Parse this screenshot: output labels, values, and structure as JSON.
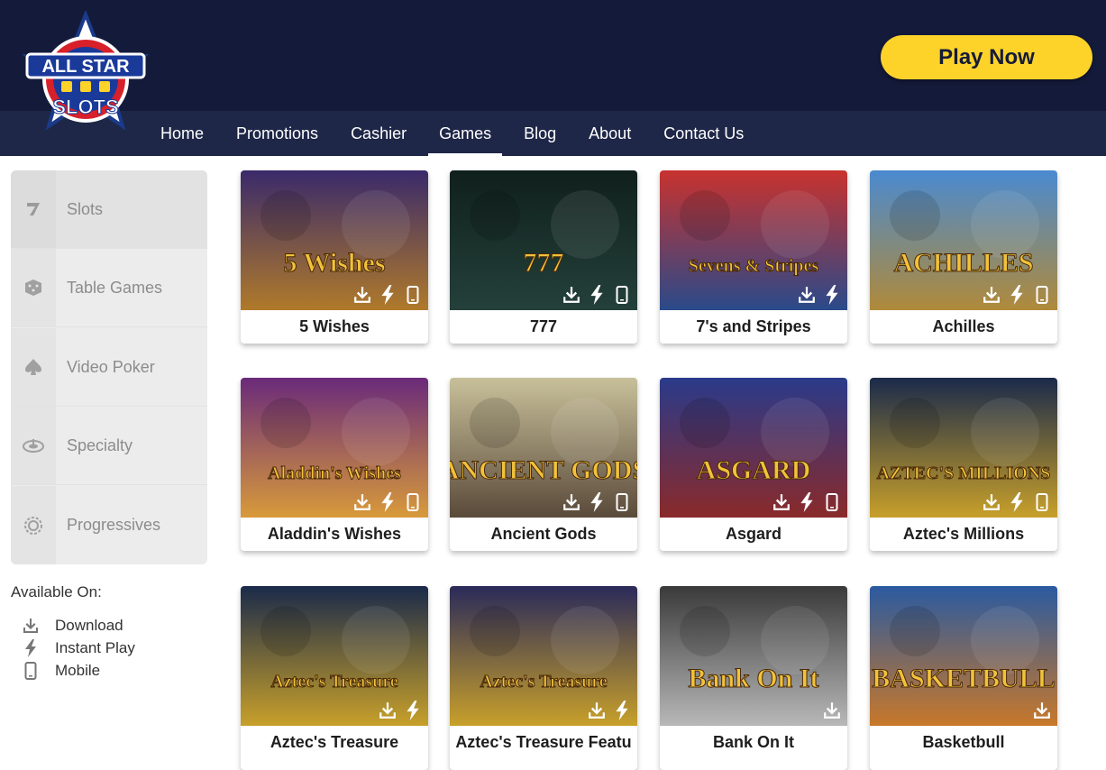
{
  "brand": {
    "logo_line1": "ALL STAR",
    "logo_line2": "SLOTS"
  },
  "header": {
    "play_now_label": "Play Now"
  },
  "nav": {
    "items": [
      {
        "label": "Home"
      },
      {
        "label": "Promotions"
      },
      {
        "label": "Cashier"
      },
      {
        "label": "Games",
        "active": true
      },
      {
        "label": "Blog"
      },
      {
        "label": "About"
      },
      {
        "label": "Contact Us"
      }
    ]
  },
  "sidebar": {
    "categories": [
      {
        "label": "Slots",
        "icon": "seven-icon",
        "active": true
      },
      {
        "label": "Table Games",
        "icon": "dice-icon"
      },
      {
        "label": "Video Poker",
        "icon": "spade-icon"
      },
      {
        "label": "Specialty",
        "icon": "wheel-icon"
      },
      {
        "label": "Progressives",
        "icon": "progressive-icon"
      }
    ],
    "available_on": {
      "title": "Available On:",
      "items": [
        {
          "label": "Download",
          "icon": "download-icon"
        },
        {
          "label": "Instant Play",
          "icon": "lightning-icon"
        },
        {
          "label": "Mobile",
          "icon": "mobile-icon"
        }
      ]
    }
  },
  "games": [
    {
      "title": "5 Wishes",
      "art_text": "5 Wishes",
      "download": true,
      "instant": true,
      "mobile": true,
      "bg": [
        "#3a2a6a",
        "#b07a2a"
      ]
    },
    {
      "title": "777",
      "art_text": "777",
      "download": true,
      "instant": true,
      "mobile": true,
      "bg": [
        "#10201c",
        "#24403a"
      ]
    },
    {
      "title": "7's and Stripes",
      "art_text": "Sevens & Stripes",
      "download": true,
      "instant": true,
      "mobile": false,
      "bg": [
        "#c8322e",
        "#2a4a8a"
      ]
    },
    {
      "title": "Achilles",
      "art_text": "ACHILLES",
      "download": true,
      "instant": true,
      "mobile": true,
      "bg": [
        "#4a8ad0",
        "#b08a3a"
      ]
    },
    {
      "title": "Aladdin's Wishes",
      "art_text": "Aladdin's Wishes",
      "download": true,
      "instant": true,
      "mobile": true,
      "bg": [
        "#6a2a7a",
        "#d89a3a"
      ]
    },
    {
      "title": "Ancient Gods",
      "art_text": "ANCIENT GODS",
      "download": true,
      "instant": true,
      "mobile": true,
      "bg": [
        "#c8c09a",
        "#5a4a3a"
      ]
    },
    {
      "title": "Asgard",
      "art_text": "ASGARD",
      "download": true,
      "instant": true,
      "mobile": true,
      "bg": [
        "#2a3a8a",
        "#8a2a2a"
      ]
    },
    {
      "title": "Aztec's Millions",
      "art_text": "AZTEC'S MILLIONS",
      "download": true,
      "instant": true,
      "mobile": true,
      "bg": [
        "#1a2a4a",
        "#c8a02a"
      ]
    },
    {
      "title": "Aztec's Treasure",
      "art_text": "Aztec's Treasure",
      "download": true,
      "instant": true,
      "mobile": false,
      "bg": [
        "#1a2a4a",
        "#c8a02a"
      ]
    },
    {
      "title": "Aztec's Treasure Featu",
      "art_text": "Aztec's Treasure",
      "download": true,
      "instant": true,
      "mobile": false,
      "bg": [
        "#2a2a5a",
        "#c8a02a"
      ]
    },
    {
      "title": "Bank On It",
      "art_text": "Bank On It",
      "download": true,
      "instant": false,
      "mobile": false,
      "bg": [
        "#3a3a3a",
        "#b8b8b8"
      ]
    },
    {
      "title": "Basketbull",
      "art_text": "BASKETBULL",
      "download": true,
      "instant": false,
      "mobile": false,
      "bg": [
        "#2a5aa0",
        "#c8782a"
      ]
    }
  ],
  "colors": {
    "header_bg": "#141a3a",
    "nav_bg": "#1f2748",
    "accent_yellow": "#fdd32a"
  }
}
